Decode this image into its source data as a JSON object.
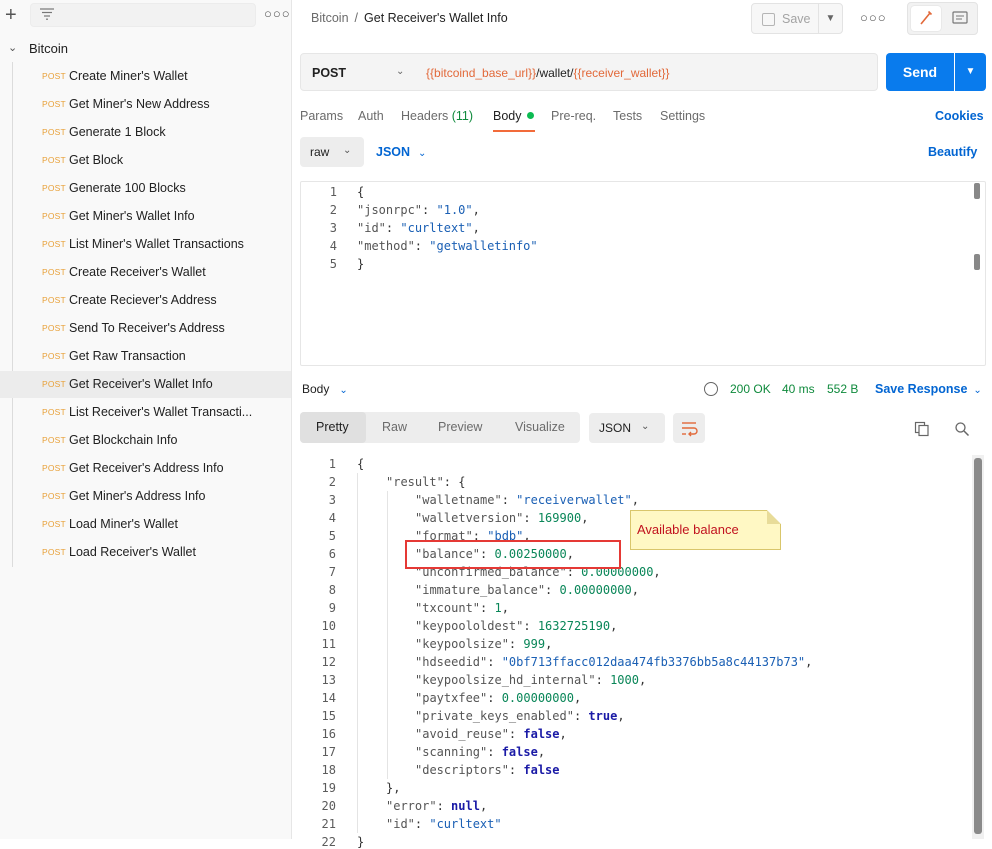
{
  "sidebar": {
    "collection": "Bitcoin",
    "requests": [
      {
        "method": "POST",
        "name": "Create Miner's Wallet"
      },
      {
        "method": "POST",
        "name": "Get Miner's New Address"
      },
      {
        "method": "POST",
        "name": "Generate 1 Block"
      },
      {
        "method": "POST",
        "name": "Get Block"
      },
      {
        "method": "POST",
        "name": "Generate 100 Blocks"
      },
      {
        "method": "POST",
        "name": "Get Miner's Wallet Info"
      },
      {
        "method": "POST",
        "name": "List Miner's Wallet Transactions"
      },
      {
        "method": "POST",
        "name": "Create Receiver's Wallet"
      },
      {
        "method": "POST",
        "name": "Create Reciever's Address"
      },
      {
        "method": "POST",
        "name": "Send To Receiver's Address"
      },
      {
        "method": "POST",
        "name": "Get Raw Transaction"
      },
      {
        "method": "POST",
        "name": "Get Receiver's Wallet Info",
        "active": true
      },
      {
        "method": "POST",
        "name": "List Receiver's Wallet Transacti..."
      },
      {
        "method": "POST",
        "name": "Get Blockchain Info"
      },
      {
        "method": "POST",
        "name": "Get Receiver's Address Info"
      },
      {
        "method": "POST",
        "name": "Get Miner's Address Info"
      },
      {
        "method": "POST",
        "name": "Load Miner's Wallet"
      },
      {
        "method": "POST",
        "name": "Load Receiver's Wallet"
      }
    ]
  },
  "header": {
    "breadcrumb_parent": "Bitcoin",
    "breadcrumb_sep": "/",
    "title": "Get Receiver's Wallet Info",
    "save_label": "Save"
  },
  "request": {
    "method": "POST",
    "url_var1": "{{bitcoind_base_url}}",
    "url_mid": "/wallet/",
    "url_var2": "{{receiver_wallet}}",
    "send_label": "Send"
  },
  "tabs": {
    "params": "Params",
    "auth": "Auth",
    "headers": "Headers",
    "headers_count": "(11)",
    "body": "Body",
    "prereq": "Pre-req.",
    "tests": "Tests",
    "settings": "Settings",
    "cookies": "Cookies"
  },
  "body_options": {
    "mode": "raw",
    "language": "JSON",
    "beautify": "Beautify"
  },
  "request_body": [
    {
      "n": "1",
      "code": "{"
    },
    {
      "n": "2",
      "code": "\"jsonrpc\": \"1.0\","
    },
    {
      "n": "3",
      "code": "\"id\": \"curltext\","
    },
    {
      "n": "4",
      "code": "\"method\": \"getwalletinfo\""
    },
    {
      "n": "5",
      "code": "}"
    }
  ],
  "response": {
    "section_label": "Body",
    "status": "200 OK",
    "time": "40 ms",
    "size": "552 B",
    "save_response": "Save Response",
    "view_tabs": [
      "Pretty",
      "Raw",
      "Preview",
      "Visualize"
    ],
    "format": "JSON"
  },
  "response_body": [
    {
      "n": "1",
      "indent": 0,
      "parts": [
        [
          "p",
          "{"
        ]
      ]
    },
    {
      "n": "2",
      "indent": 1,
      "parts": [
        [
          "k",
          "\"result\""
        ],
        [
          "p",
          ": {"
        ]
      ]
    },
    {
      "n": "3",
      "indent": 2,
      "parts": [
        [
          "k",
          "\"walletname\""
        ],
        [
          "p",
          ": "
        ],
        [
          "s",
          "\"receiverwallet\""
        ],
        [
          "p",
          ","
        ]
      ]
    },
    {
      "n": "4",
      "indent": 2,
      "parts": [
        [
          "k",
          "\"walletversion\""
        ],
        [
          "p",
          ": "
        ],
        [
          "num",
          "169900"
        ],
        [
          "p",
          ","
        ]
      ]
    },
    {
      "n": "5",
      "indent": 2,
      "parts": [
        [
          "k",
          "\"format\""
        ],
        [
          "p",
          ": "
        ],
        [
          "s",
          "\"bdb\""
        ],
        [
          "p",
          ","
        ]
      ]
    },
    {
      "n": "6",
      "indent": 2,
      "parts": [
        [
          "k",
          "\"balance\""
        ],
        [
          "p",
          ": "
        ],
        [
          "num",
          "0.00250000"
        ],
        [
          "p",
          ","
        ]
      ]
    },
    {
      "n": "7",
      "indent": 2,
      "parts": [
        [
          "k",
          "\"unconfirmed_balance\""
        ],
        [
          "p",
          ": "
        ],
        [
          "num",
          "0.00000000"
        ],
        [
          "p",
          ","
        ]
      ]
    },
    {
      "n": "8",
      "indent": 2,
      "parts": [
        [
          "k",
          "\"immature_balance\""
        ],
        [
          "p",
          ": "
        ],
        [
          "num",
          "0.00000000"
        ],
        [
          "p",
          ","
        ]
      ]
    },
    {
      "n": "9",
      "indent": 2,
      "parts": [
        [
          "k",
          "\"txcount\""
        ],
        [
          "p",
          ": "
        ],
        [
          "num",
          "1"
        ],
        [
          "p",
          ","
        ]
      ]
    },
    {
      "n": "10",
      "indent": 2,
      "parts": [
        [
          "k",
          "\"keypoololdest\""
        ],
        [
          "p",
          ": "
        ],
        [
          "num",
          "1632725190"
        ],
        [
          "p",
          ","
        ]
      ]
    },
    {
      "n": "11",
      "indent": 2,
      "parts": [
        [
          "k",
          "\"keypoolsize\""
        ],
        [
          "p",
          ": "
        ],
        [
          "num",
          "999"
        ],
        [
          "p",
          ","
        ]
      ]
    },
    {
      "n": "12",
      "indent": 2,
      "parts": [
        [
          "k",
          "\"hdseedid\""
        ],
        [
          "p",
          ": "
        ],
        [
          "s",
          "\"0bf713ffacc012daa474fb3376bb5a8c44137b73\""
        ],
        [
          "p",
          ","
        ]
      ]
    },
    {
      "n": "13",
      "indent": 2,
      "parts": [
        [
          "k",
          "\"keypoolsize_hd_internal\""
        ],
        [
          "p",
          ": "
        ],
        [
          "num",
          "1000"
        ],
        [
          "p",
          ","
        ]
      ]
    },
    {
      "n": "14",
      "indent": 2,
      "parts": [
        [
          "k",
          "\"paytxfee\""
        ],
        [
          "p",
          ": "
        ],
        [
          "num",
          "0.00000000"
        ],
        [
          "p",
          ","
        ]
      ]
    },
    {
      "n": "15",
      "indent": 2,
      "parts": [
        [
          "k",
          "\"private_keys_enabled\""
        ],
        [
          "p",
          ": "
        ],
        [
          "kw",
          "true"
        ],
        [
          "p",
          ","
        ]
      ]
    },
    {
      "n": "16",
      "indent": 2,
      "parts": [
        [
          "k",
          "\"avoid_reuse\""
        ],
        [
          "p",
          ": "
        ],
        [
          "kw",
          "false"
        ],
        [
          "p",
          ","
        ]
      ]
    },
    {
      "n": "17",
      "indent": 2,
      "parts": [
        [
          "k",
          "\"scanning\""
        ],
        [
          "p",
          ": "
        ],
        [
          "kw",
          "false"
        ],
        [
          "p",
          ","
        ]
      ]
    },
    {
      "n": "18",
      "indent": 2,
      "parts": [
        [
          "k",
          "\"descriptors\""
        ],
        [
          "p",
          ": "
        ],
        [
          "kw",
          "false"
        ]
      ]
    },
    {
      "n": "19",
      "indent": 1,
      "parts": [
        [
          "p",
          "},"
        ]
      ]
    },
    {
      "n": "20",
      "indent": 1,
      "parts": [
        [
          "k",
          "\"error\""
        ],
        [
          "p",
          ": "
        ],
        [
          "kw",
          "null"
        ],
        [
          "p",
          ","
        ]
      ]
    },
    {
      "n": "21",
      "indent": 1,
      "parts": [
        [
          "k",
          "\"id\""
        ],
        [
          "p",
          ": "
        ],
        [
          "s",
          "\"curltext\""
        ]
      ]
    },
    {
      "n": "22",
      "indent": 0,
      "parts": [
        [
          "p",
          "}"
        ]
      ]
    }
  ],
  "annotation": {
    "note": "Available balance"
  },
  "colors": {
    "accent_blue": "#097bed",
    "method_post": "#e8a13a",
    "tab_underline": "#f26b3a",
    "status_green": "#0f8a3c",
    "highlight_red": "#e53935",
    "note_bg": "#fff8c4"
  },
  "icons": [
    "plus-icon",
    "filter-icon",
    "more-icon",
    "chevron-down-icon",
    "save-icon",
    "edit-icon",
    "comment-icon",
    "globe-icon",
    "wrap-lines-icon",
    "copy-icon",
    "search-icon"
  ]
}
